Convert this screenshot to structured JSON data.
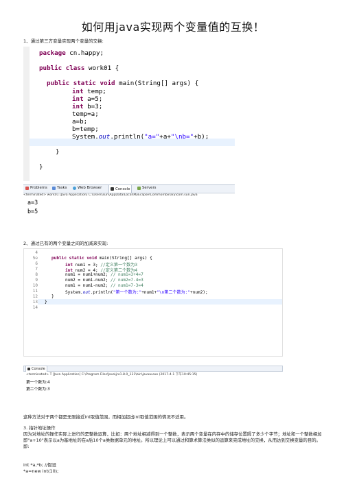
{
  "title": "如何用java实现两个变量值的互换！",
  "step1": "1、通过第三方变量实现两个变量的交换:",
  "code1": [
    {
      "t": "package",
      "r": " cn.happy;"
    },
    {
      "t": "public class",
      "r": " work01 {"
    },
    {
      "t": "public static void",
      "r": " main(String[] args) {"
    },
    {
      "t": "int",
      "r": " temp;"
    },
    {
      "t": "int",
      "r": " a=5;"
    },
    {
      "t": "int",
      "r": " b=3;"
    },
    {
      "t": "",
      "r": "temp=a;"
    },
    {
      "t": "",
      "r": "a=b;"
    },
    {
      "t": "",
      "r": "b=temp;"
    },
    {
      "t": "",
      "r": "System."
    },
    {
      "t": "",
      "r": "}"
    },
    {
      "t": "",
      "r": "}"
    }
  ],
  "code1_println": {
    "out": "out",
    "rest1": ".println(",
    "s1": "\"a=\"",
    "mid": "+a+",
    "s2": "\"\\nb=\"",
    "end": "+b);"
  },
  "tabs1": [
    "Problems",
    "Tasks",
    "Web Browser",
    "Console",
    "Servers"
  ],
  "tabs1_icons": [
    "problems-icon",
    "tasks-icon",
    "web-browser-icon",
    "console-icon",
    "servers-icon"
  ],
  "terminated1": "<terminated> work01 [Java Application] C:\\Users\\sun\\AppData\\Local\\MyEclipse\\Common\\binary\\com.sun.java",
  "output1": [
    "a=3",
    "b=5"
  ],
  "step2": "2、通过已有的两个变量之间的加减来实现:",
  "code2_lines": [
    {
      "n": "4",
      "code": ""
    },
    {
      "n": "5⊖",
      "kw": "public static void",
      "code": " main(String[] args) {"
    },
    {
      "n": "6",
      "kw": "int",
      "code": " num1 = 3; ",
      "cm": "//定义第一个数为3"
    },
    {
      "n": "7",
      "kw": "int",
      "code": " num2 = 4; ",
      "cm": "//定义第二个数为4"
    },
    {
      "n": "8",
      "code": "num1 = num1+num2; ",
      "cm": "// num1=3+4=7"
    },
    {
      "n": "9",
      "code": "num2 = num1-num2; ",
      "cm": "// num2=7-4=3"
    },
    {
      "n": "10",
      "code": "num1 = num1-num2; ",
      "cm": "// num1=7-3=4"
    },
    {
      "n": "11",
      "code": "System.",
      "fld": "out",
      "code2": ".println(",
      "s": "\"第一个数为:\"",
      "code3": "+num1+",
      "s2": "\"\\n第二个数为:\"",
      "code4": "+num2);"
    },
    {
      "n": "12",
      "code": "}"
    },
    {
      "n": "13",
      "code": "}"
    },
    {
      "n": "14",
      "code": ""
    }
  ],
  "tabs2": [
    "Console"
  ],
  "terminated2": "<terminated> T [Java Application] C:\\Program Files\\Java\\jre1.8.0_121\\bin\\javaw.exe (2017-4-1 下午10:45:15)",
  "output2": [
    "第一个数为:4",
    "第二个数为:3"
  ],
  "note": "这种方法对于两个都是无限接近int取值范围，而相加超出int取值范围的情况不适用。",
  "step3": "3. 指针地址操作",
  "para3": "因为对地址的操作实际上进行的是整数运算，比如：两个地址相减得到一个整数，表示两个变量在内存中的储存位置隔了多少个字节；地址和一个整数相加即\"a+10\"表示以a为基地址的在a后10个a类数据单元的地址。所以理论上可以通过和算术算法类似的运算来完成地址的交换，从而达到交换变量的目的。即:",
  "code3": [
    "int *a,*b; //假设",
    "*a=new int(10);"
  ]
}
